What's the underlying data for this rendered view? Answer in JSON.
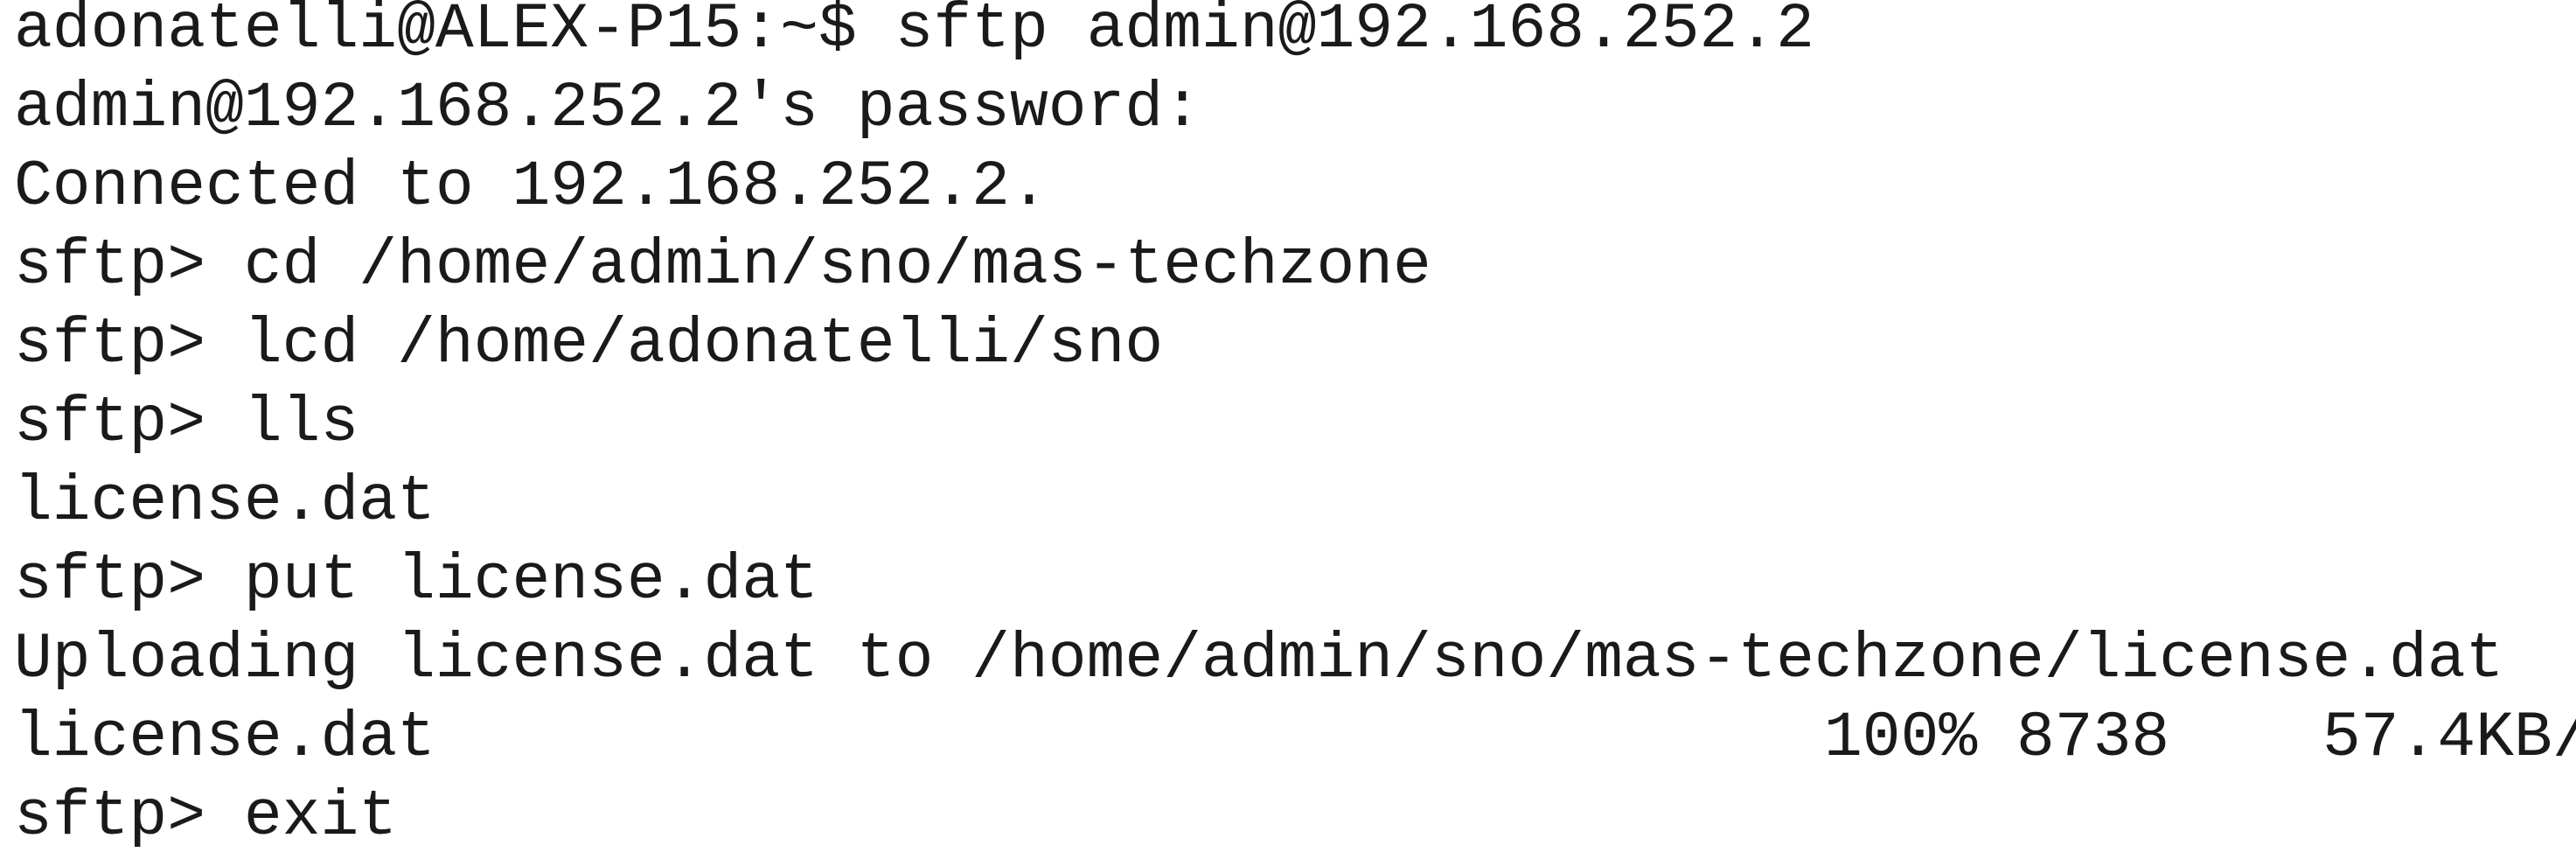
{
  "terminal": {
    "lines": [
      "adonatelli@ALEX-P15:~$ sftp admin@192.168.252.2",
      "admin@192.168.252.2's password:",
      "Connected to 192.168.252.2.",
      "sftp> cd /home/admin/sno/mas-techzone",
      "sftp> lcd /home/adonatelli/sno",
      "sftp> lls",
      "license.dat",
      "sftp> put license.dat",
      "Uploading license.dat to /home/admin/sno/mas-techzone/license.dat",
      "sftp> exit"
    ],
    "progress": {
      "file": "license.dat",
      "percent": "100%",
      "bytes": "8738",
      "rate": "57.4KB/"
    }
  }
}
